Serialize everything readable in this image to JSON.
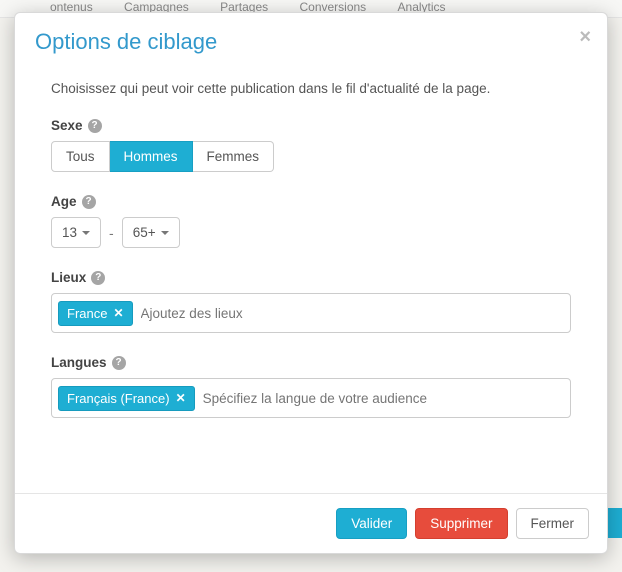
{
  "bg_nav": [
    "ontenus",
    "Campagnes",
    "Partages",
    "Conversions",
    "Analytics"
  ],
  "modal": {
    "title": "Options de ciblage",
    "close_x": "×",
    "intro": "Choisissez qui peut voir cette publication dans le fil d'actualité de la page.",
    "sex": {
      "label": "Sexe",
      "options": [
        "Tous",
        "Hommes",
        "Femmes"
      ],
      "active_index": 1
    },
    "age": {
      "label": "Age",
      "min": "13",
      "max": "65+",
      "dash": "-"
    },
    "places": {
      "label": "Lieux",
      "tags": [
        "France"
      ],
      "placeholder": "Ajoutez des lieux"
    },
    "languages": {
      "label": "Langues",
      "tags": [
        "Français (France)"
      ],
      "placeholder": "Spécifiez la langue de votre audience"
    },
    "footer": {
      "validate": "Valider",
      "delete": "Supprimer",
      "close": "Fermer"
    },
    "help_glyph": "?",
    "tag_x": "✕"
  }
}
